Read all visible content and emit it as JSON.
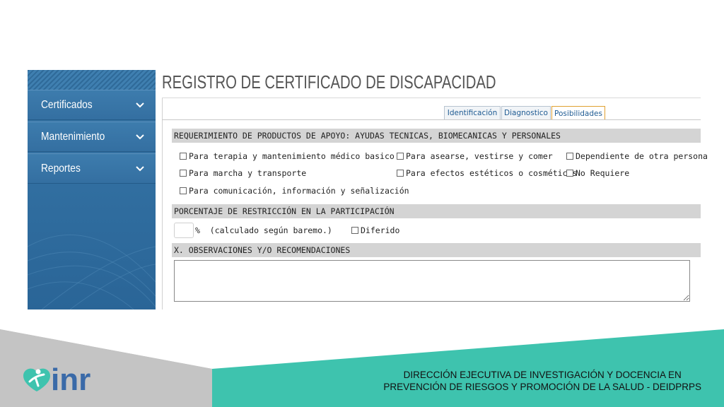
{
  "sidebar": {
    "items": [
      {
        "label": "Certificados",
        "icon": "chevron-down-icon"
      },
      {
        "label": "Mantenimiento",
        "icon": "chevron-down-icon"
      },
      {
        "label": "Reportes",
        "icon": "chevron-down-icon"
      }
    ]
  },
  "main": {
    "title": "REGISTRO DE CERTIFICADO DE DISCAPACIDAD",
    "tabs": [
      {
        "label": "Identificación",
        "active": false
      },
      {
        "label": "Diagnostico",
        "active": false
      },
      {
        "label": "Posibilidades",
        "active": true
      }
    ],
    "sections": {
      "productos": {
        "header": "REQUERIMIENTO DE PRODUCTOS DE APOYO: AYUDAS TECNICAS, BIOMECANICAS Y PERSONALES",
        "options": [
          "Para terapia y mantenimiento médico basico",
          "Para asearse, vestirse y comer",
          "Dependiente de otra persona",
          "Para marcha y transporte",
          "Para efectos estéticos o cosméticos",
          "No Requiere",
          "Para comunicación, información y señalización"
        ]
      },
      "porcentaje": {
        "header": "PORCENTAJE DE RESTRICCIÓN EN LA PARTICIPACIÓN",
        "input_value": "",
        "suffix": "%  (calculado según baremo.)",
        "diferido_label": "Diferido"
      },
      "observaciones": {
        "header": "X. OBSERVACIONES Y/O RECOMENDACIONES",
        "value": ""
      }
    }
  },
  "footer": {
    "line1": "DIRECCIÓN EJECUTIVA DE INVESTIGACIÓN Y DOCENCIA EN",
    "line2": "PREVENCIÓN DE RIESGOS Y PROMOCIÓN DE LA SALUD - DEIDPRPS",
    "logo_text": "inr"
  },
  "colors": {
    "sidebar": "#3a78a8",
    "tab_active_border": "#e0a030",
    "tab_text": "#1f5b93",
    "section_header_bg": "#d4d4d4",
    "footer_gray": "#c4c4c4",
    "footer_teal": "#3ec3ae",
    "logo_blue": "#3a6aa8"
  }
}
